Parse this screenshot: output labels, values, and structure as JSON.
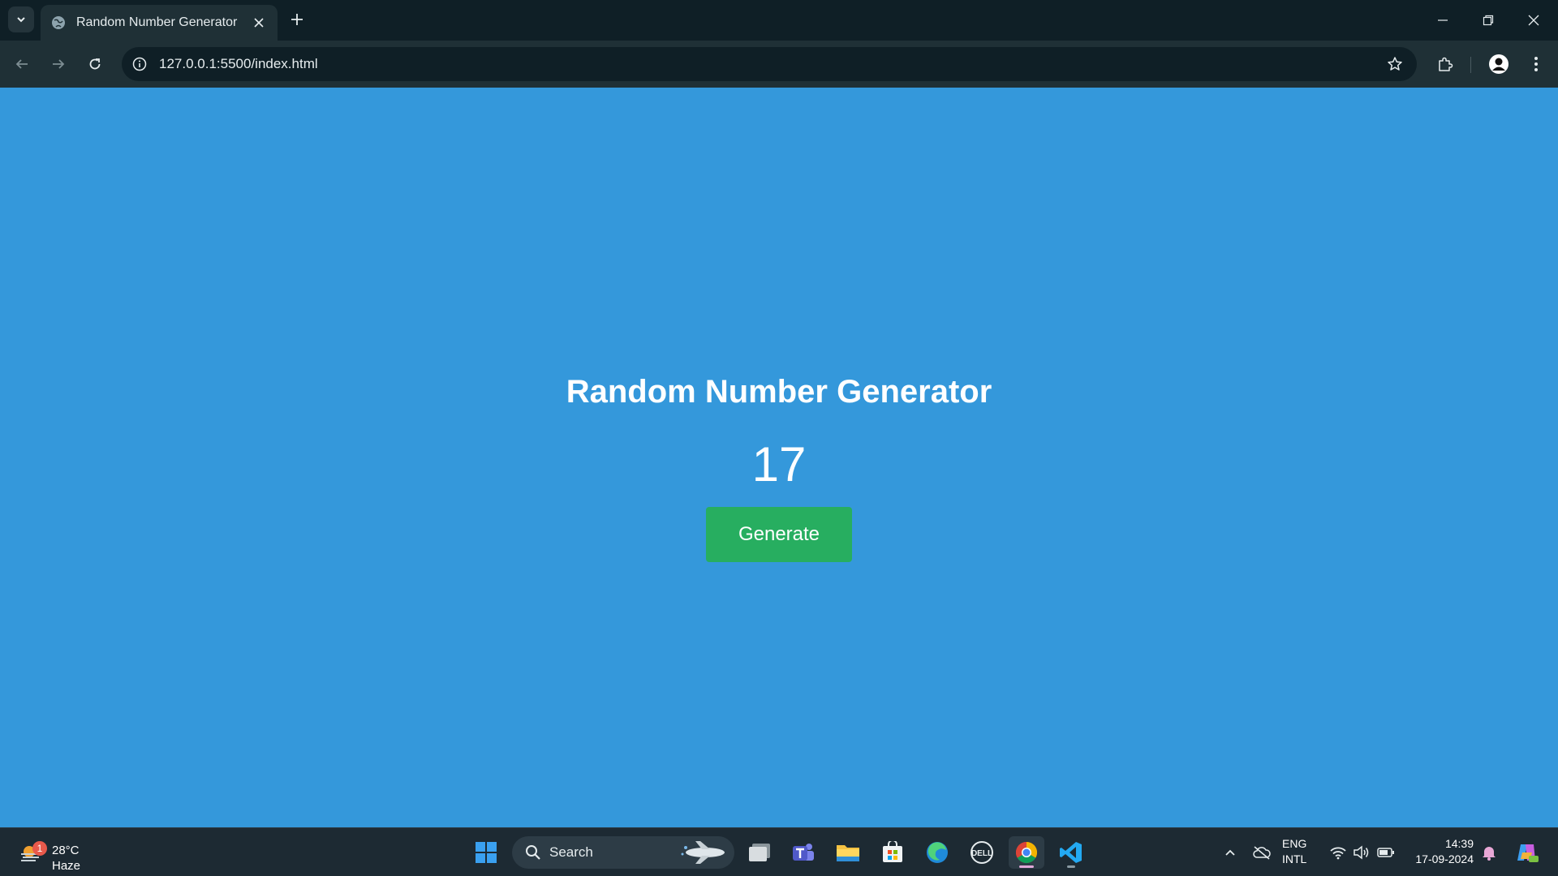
{
  "browser": {
    "tab": {
      "title": "Random Number Generator"
    },
    "address_bar": {
      "url": "127.0.0.1:5500/index.html"
    }
  },
  "page": {
    "heading": "Random Number Generator",
    "number": "17",
    "button_label": "Generate"
  },
  "taskbar": {
    "weather": {
      "temperature": "28°C",
      "condition": "Haze",
      "badge": "1"
    },
    "search": {
      "placeholder": "Search"
    },
    "tray": {
      "language_line1": "ENG",
      "language_line2": "INTL"
    },
    "clock": {
      "time": "14:39",
      "date": "17-09-2024"
    }
  },
  "colors": {
    "page_background": "#3498db",
    "button_background": "#27ae60",
    "browser_frame": "#0f1f26",
    "toolbar": "#1f3036",
    "taskbar": "#1d2a33"
  },
  "icons": {
    "taskbar_apps": [
      "windows-start-icon",
      "task-view-icon",
      "teams-icon",
      "file-explorer-icon",
      "microsoft-store-icon",
      "edge-icon",
      "dell-icon",
      "chrome-icon",
      "vscode-icon"
    ]
  }
}
